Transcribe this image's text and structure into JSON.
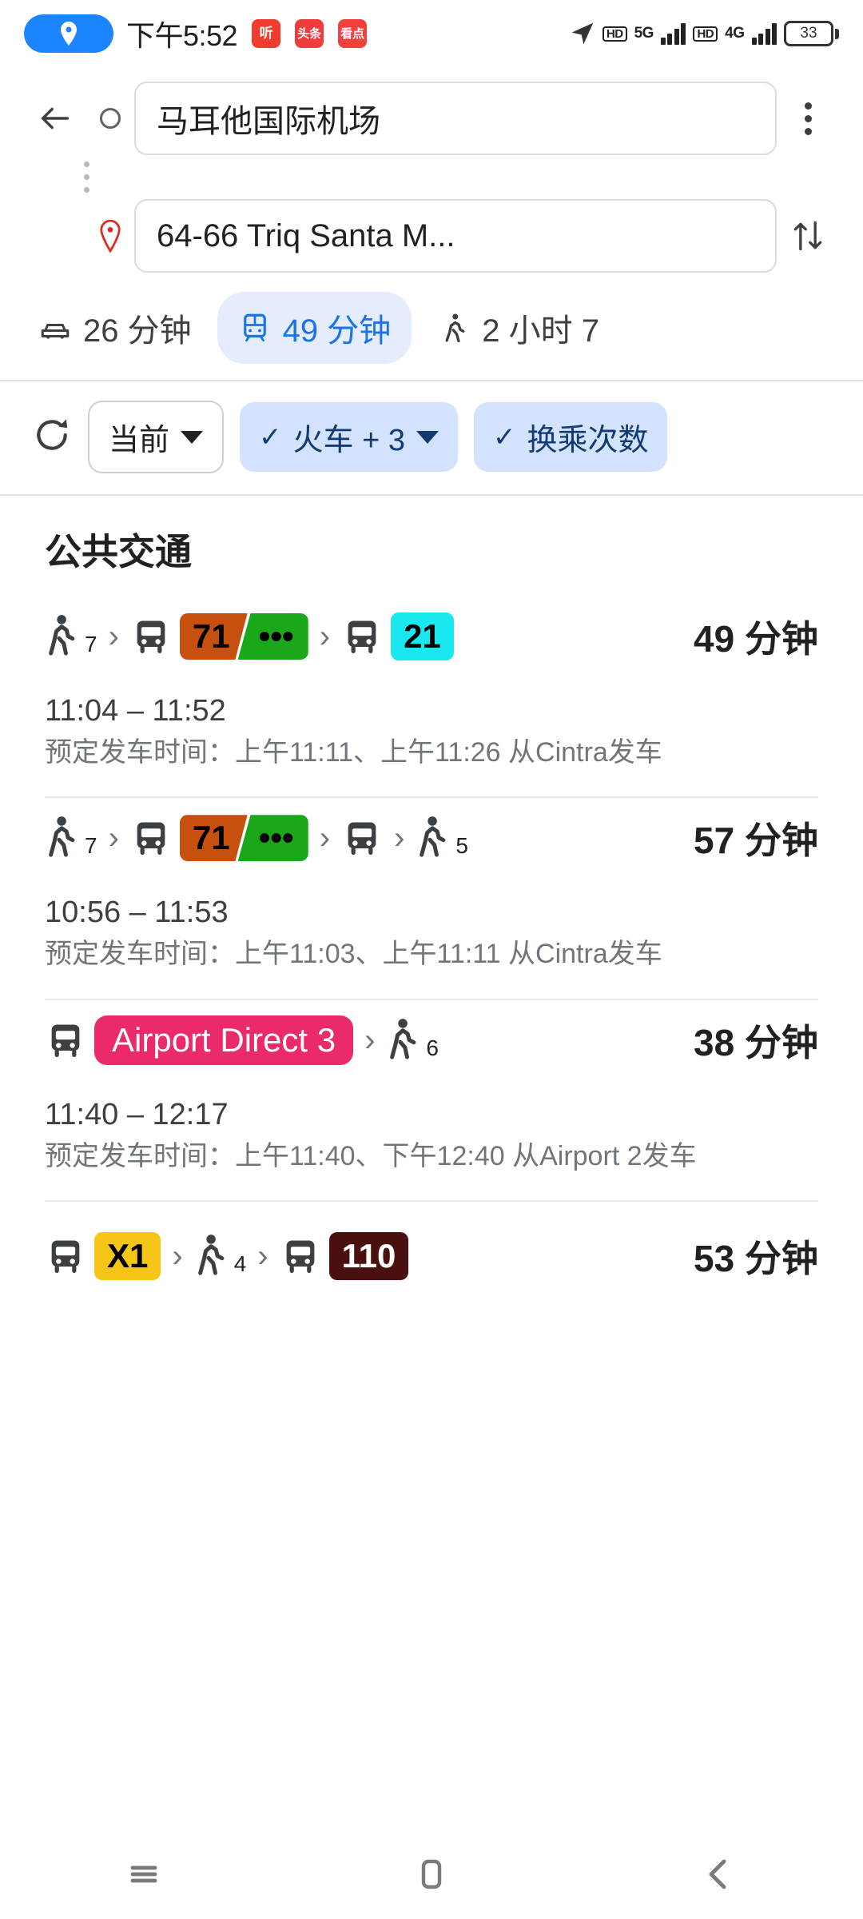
{
  "status_bar": {
    "time": "下午5:52",
    "location_icon": "location-pin-icon",
    "app_icons": [
      {
        "name": "ting-icon",
        "label": "听"
      },
      {
        "name": "toutiao-icon",
        "label": "头条"
      },
      {
        "name": "kandian-icon",
        "label": "看点"
      }
    ],
    "navigation_icon": "navigation-arrow-icon",
    "hd_label_1": "HD",
    "network_1": "5G",
    "hd_label_2": "HD",
    "network_2": "4G",
    "battery_percent": "33"
  },
  "header": {
    "back_icon": "back-arrow-icon",
    "origin_icon": "origin-circle-icon",
    "origin_value": "马耳他国际机场",
    "destination_icon": "destination-pin-icon",
    "destination_value": "64-66 Triq Santa M...",
    "overflow_icon": "more-vertical-icon",
    "swap_icon": "swap-vertical-icon"
  },
  "modes": [
    {
      "icon": "car-icon",
      "label": "26 分钟",
      "active": false
    },
    {
      "icon": "transit-icon",
      "label": "49 分钟",
      "active": true
    },
    {
      "icon": "walk-icon",
      "label": "2 小时 7",
      "active": false
    }
  ],
  "filters": {
    "refresh_icon": "refresh-icon",
    "chips": [
      {
        "label": "当前",
        "selected": false,
        "has_caret": true,
        "has_check": false
      },
      {
        "label": "火车 + 3",
        "selected": true,
        "has_caret": true,
        "has_check": true
      },
      {
        "label": "换乘次数",
        "selected": true,
        "has_caret": false,
        "has_check": true
      }
    ]
  },
  "results": {
    "section_title": "公共交通",
    "routes": [
      {
        "legs": [
          {
            "type": "walk",
            "minutes": "7"
          },
          {
            "type": "transit",
            "vehicle": "bus-icon",
            "badges": [
              {
                "text": "71",
                "bg": "#c8500f",
                "fg": "#000000"
              },
              {
                "text": "•••",
                "bg": "#1aa81a",
                "fg": "#000000"
              }
            ]
          },
          {
            "type": "transit",
            "vehicle": "bus-icon",
            "badges": [
              {
                "text": "21",
                "bg": "#1ae8f0",
                "fg": "#000000"
              }
            ]
          }
        ],
        "duration": "49 分钟",
        "times": "11:04 – 11:52",
        "scheduled": "预定发车时间：上午11:11、上午11:26 从Cintra发车"
      },
      {
        "legs": [
          {
            "type": "walk",
            "minutes": "7"
          },
          {
            "type": "transit",
            "vehicle": "bus-icon",
            "badges": [
              {
                "text": "71",
                "bg": "#c8500f",
                "fg": "#000000"
              },
              {
                "text": "•••",
                "bg": "#1aa81a",
                "fg": "#000000"
              }
            ]
          },
          {
            "type": "transit",
            "vehicle": "bus-icon",
            "badges": []
          },
          {
            "type": "walk",
            "minutes": "5"
          }
        ],
        "duration": "57 分钟",
        "times": "10:56 – 11:53",
        "scheduled": "预定发车时间：上午11:03、上午11:11 从Cintra发车"
      },
      {
        "legs": [
          {
            "type": "transit",
            "vehicle": "bus-icon",
            "badges": [
              {
                "text": "Airport Direct 3",
                "bg": "#ea2a6b",
                "fg": "#ffffff",
                "pill": true
              }
            ]
          },
          {
            "type": "walk",
            "minutes": "6"
          }
        ],
        "duration": "38 分钟",
        "times": "11:40 – 12:17",
        "scheduled": "预定发车时间：上午11:40、下午12:40 从Airport 2发车"
      },
      {
        "legs": [
          {
            "type": "transit",
            "vehicle": "bus-icon",
            "badges": [
              {
                "text": "X1",
                "bg": "#f5c518",
                "fg": "#000000"
              }
            ]
          },
          {
            "type": "walk",
            "minutes": "4"
          },
          {
            "type": "transit",
            "vehicle": "bus-icon",
            "badges": [
              {
                "text": "110",
                "bg": "#4a1010",
                "fg": "#ffffff"
              }
            ]
          }
        ],
        "duration": "53 分钟",
        "times": "",
        "scheduled": ""
      }
    ]
  },
  "navbar": {
    "recents_icon": "menu-icon",
    "home_icon": "home-square-icon",
    "back_icon": "back-chevron-icon"
  },
  "colors": {
    "accent": "#1a73e8",
    "chip_selected_bg": "#d3e2fd",
    "mode_active_bg": "#e4ecfd"
  }
}
